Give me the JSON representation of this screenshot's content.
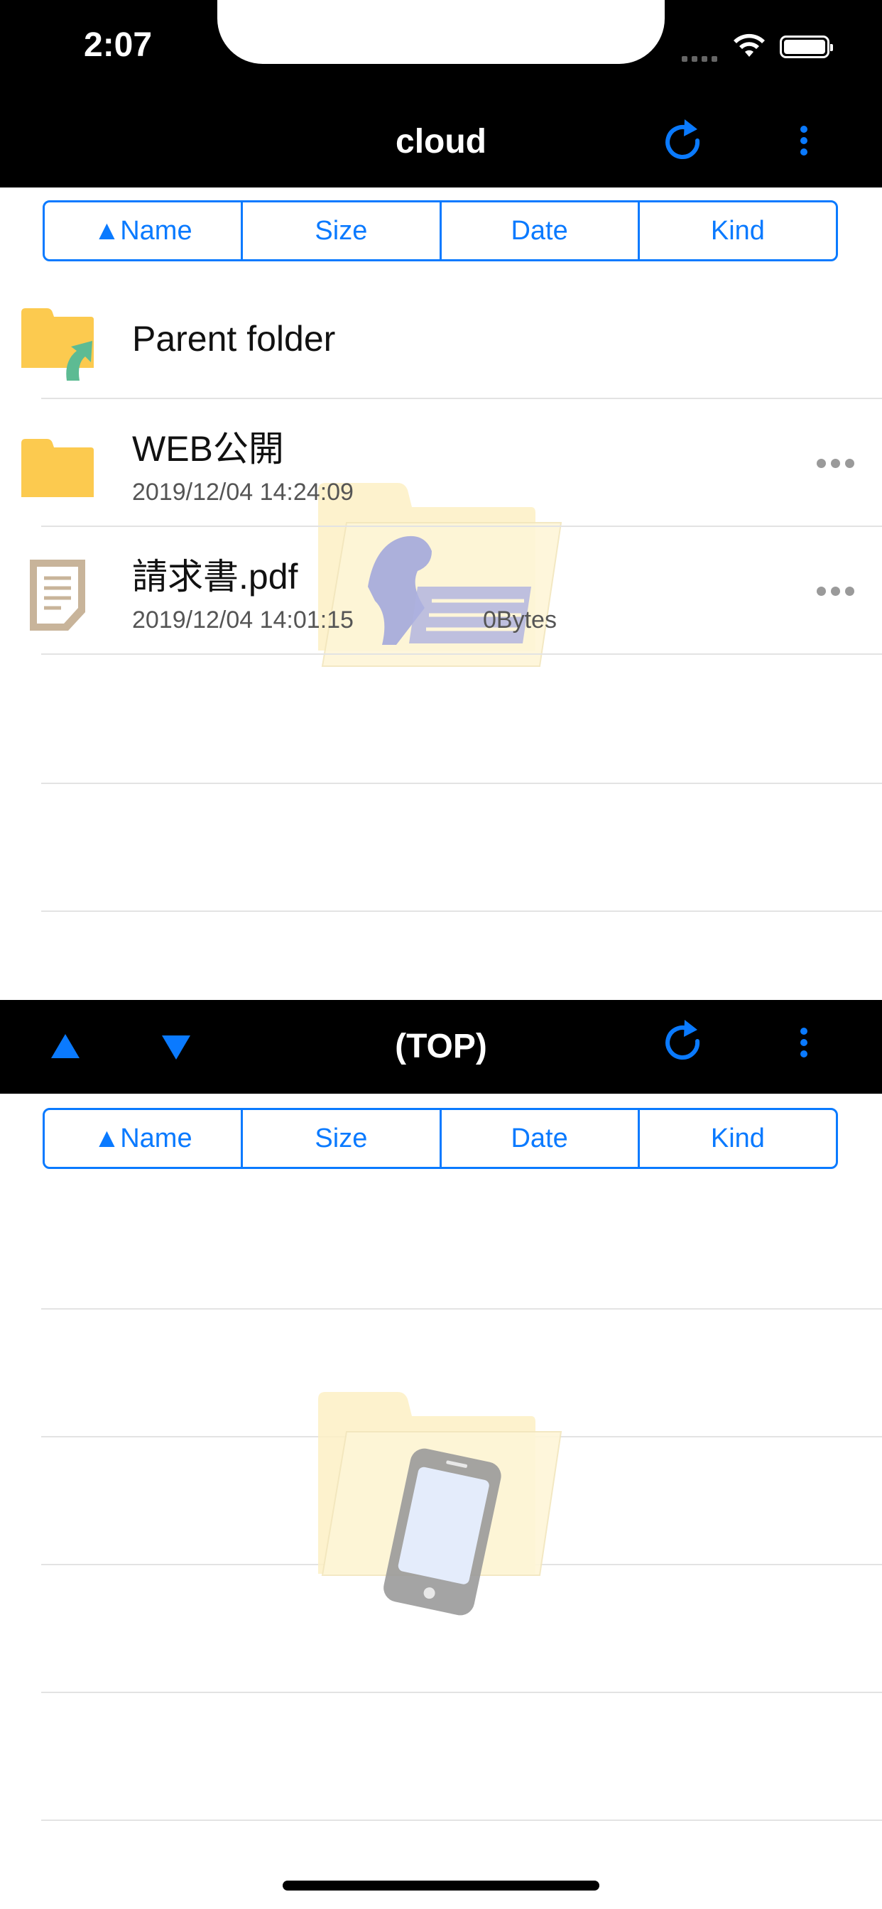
{
  "status": {
    "time": "2:07"
  },
  "top_panel": {
    "title": "cloud",
    "sort": [
      "▲Name",
      "Size",
      "Date",
      "Kind"
    ],
    "rows": [
      {
        "name": "Parent folder",
        "date": "",
        "size": "",
        "icon": "parent-folder-icon"
      },
      {
        "name": "WEB公開",
        "date": "2019/12/04 14:24:09",
        "size": "",
        "icon": "folder-icon"
      },
      {
        "name": "請求書.pdf",
        "date": "2019/12/04 14:01:15",
        "size": "0Bytes",
        "icon": "document-icon"
      }
    ]
  },
  "bottom_panel": {
    "title": "(TOP)",
    "sort": [
      "▲Name",
      "Size",
      "Date",
      "Kind"
    ]
  },
  "colors": {
    "accent": "#0a7aff",
    "folder": "#fcca4f",
    "bar": "#000000"
  }
}
